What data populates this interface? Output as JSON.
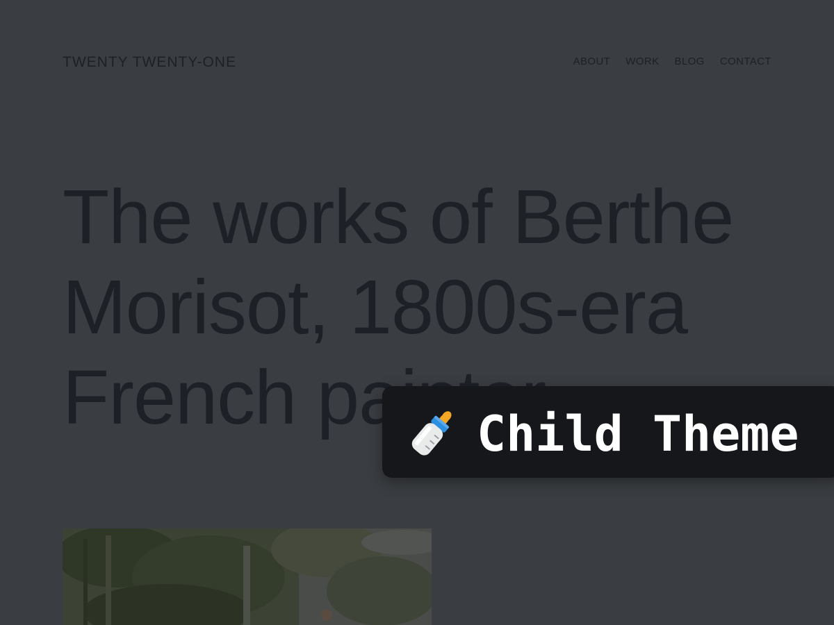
{
  "site": {
    "title": "TWENTY TWENTY-ONE"
  },
  "nav": {
    "items": [
      {
        "label": "ABOUT"
      },
      {
        "label": "WORK"
      },
      {
        "label": "BLOG"
      },
      {
        "label": "CONTACT"
      }
    ]
  },
  "hero": {
    "title": "The works of Berthe Morisot, 1800s-era French painter"
  },
  "badge": {
    "icon": "baby-bottle-icon",
    "label": "Child Theme"
  },
  "colors": {
    "page_background": "#3a3d41",
    "text": "#1d2027",
    "badge_background": "#15171b",
    "badge_text": "#ffffff"
  }
}
